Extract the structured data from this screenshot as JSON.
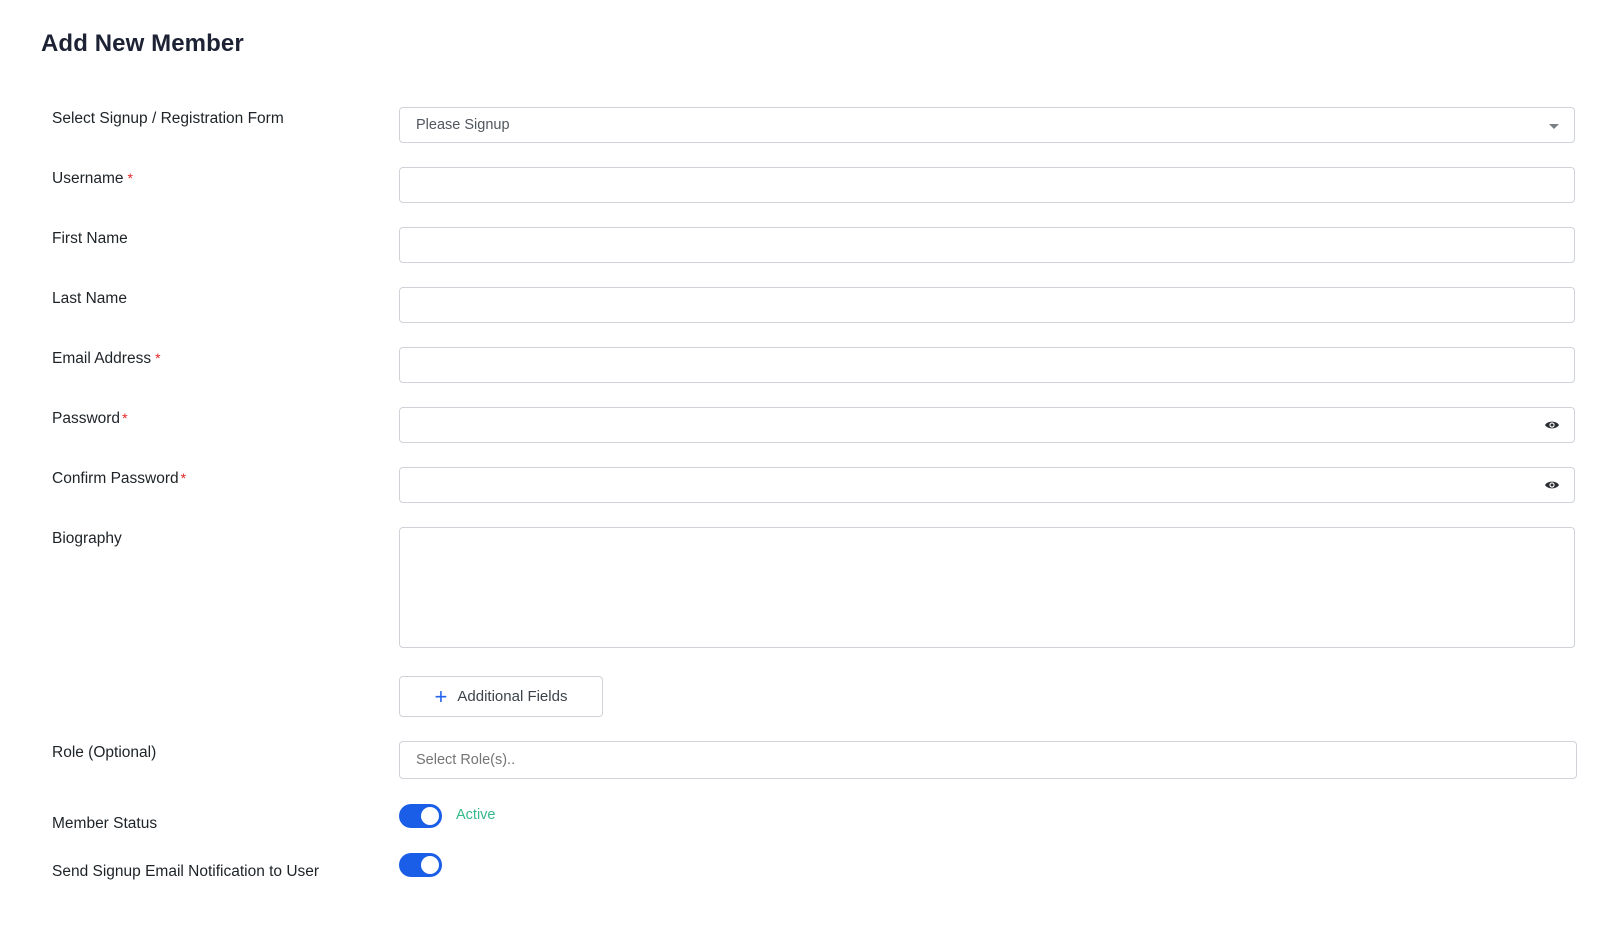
{
  "page": {
    "title": "Add New Member"
  },
  "form": {
    "signup_form": {
      "label": "Select Signup / Registration Form",
      "selected": "Please Signup"
    },
    "username": {
      "label": "Username",
      "required": "*",
      "value": ""
    },
    "first_name": {
      "label": "First Name",
      "value": ""
    },
    "last_name": {
      "label": "Last Name",
      "value": ""
    },
    "email": {
      "label": "Email Address",
      "required": "*",
      "value": ""
    },
    "password": {
      "label": "Password",
      "required": "*",
      "value": ""
    },
    "confirm_password": {
      "label": "Confirm Password",
      "required": "*",
      "value": ""
    },
    "biography": {
      "label": "Biography",
      "value": ""
    },
    "additional_fields": {
      "label": "Additional Fields"
    },
    "role": {
      "label": "Role (Optional)",
      "placeholder": "Select Role(s).."
    },
    "member_status": {
      "label": "Member Status",
      "enabled": true,
      "status_text": "Active"
    },
    "signup_notification": {
      "label": "Send Signup Email Notification to User",
      "enabled": true
    }
  },
  "colors": {
    "accent": "#1a5ee8",
    "required": "#e02424",
    "active": "#34b98a"
  },
  "icons": {
    "dropdown": "caret-down-icon",
    "password_toggle": "eye-icon",
    "add": "plus-icon"
  }
}
